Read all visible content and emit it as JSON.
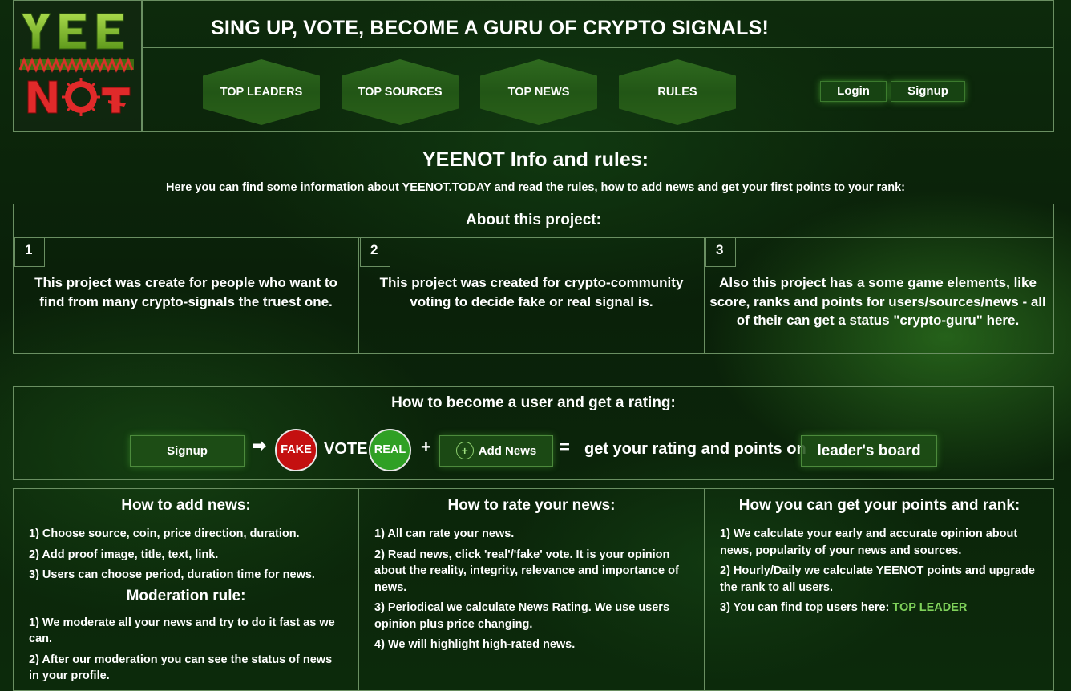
{
  "logo": {
    "line1": "YEE",
    "line2": "NOT",
    "alt": "YEENOT logo"
  },
  "header": {
    "tagline": "SING UP, VOTE, BECOME A GURU OF CRYPTO SIGNALS!",
    "nav": [
      {
        "label": "TOP LEADERS"
      },
      {
        "label": "TOP SOURCES"
      },
      {
        "label": "TOP NEWS"
      },
      {
        "label": "RULES"
      }
    ],
    "login_label": "Login",
    "signup_label": "Signup"
  },
  "info": {
    "title": "YEENOT Info and rules:",
    "subtitle": "Here you can find some information about YEENOT.TODAY and read the rules, how to add news and get your first points to your rank:"
  },
  "about": {
    "title": "About this project:",
    "items": [
      {
        "num": "1",
        "text": "This project was create for people who want to find from many crypto-signals the truest one."
      },
      {
        "num": "2",
        "text": "This project was created for crypto-community voting to decide fake or real signal is."
      },
      {
        "num": "3",
        "text": "Also this project has a some game elements, like score, ranks and points for users/sources/news - all of their can get a status \"crypto-guru\" here."
      }
    ]
  },
  "howto": {
    "title": "How to become a user and get a rating:",
    "signup_label": "Signup",
    "arrow": "➡",
    "fake_label": "FAKE",
    "vote_label": "VOTE",
    "real_label": "REAL",
    "plus": "+",
    "add_news_icon": "+",
    "add_news_label": "Add News",
    "equals": "=",
    "result_text": "get your rating and points on",
    "leaderboard_label": "leader's board"
  },
  "add_news": {
    "title": "How to add news:",
    "items": [
      "1) Choose source, coin, price direction, duration.",
      "2) Add proof image, title, text, link.",
      "3) Users can choose period, duration time for news."
    ],
    "moderation_title": "Moderation rule:",
    "moderation_items": [
      "1) We moderate all your news and try to do it fast as we can.",
      "2) After our moderation you can see the status of news in your profile."
    ]
  },
  "rate_news": {
    "title": "How to rate your news:",
    "items": [
      "1) All can rate your news.",
      "2) Read news, click 'real'/'fake' vote. It is your opinion about the reality, integrity, relevance and importance of news.",
      "3) Periodical we calculate News Rating. We use users opinion plus price changing.",
      "4) We will highlight high-rated news."
    ]
  },
  "points": {
    "title": "How you can get your points and rank:",
    "items": [
      "1) We calculate your early and accurate opinion about news, popularity of your news and sources.",
      "2) Hourly/Daily we calculate YEENOT points and upgrade the rank to all users."
    ],
    "item3_prefix": "3) You can find top users here:",
    "item3_link": "TOP LEADER"
  },
  "colors": {
    "accent_green": "#7fd15a",
    "fake_red": "#c41010",
    "real_green": "#2fa024",
    "border": "#6a8f62"
  }
}
